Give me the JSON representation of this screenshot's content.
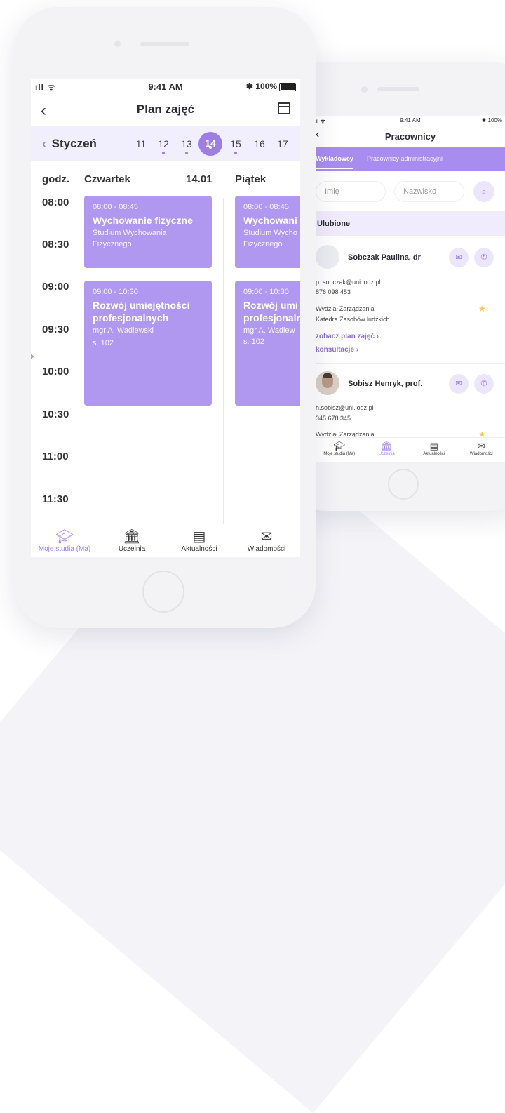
{
  "front": {
    "status": {
      "signal": "ıll ᯤ",
      "time": "9:41 AM",
      "battery": "✱ 100%"
    },
    "title": "Plan zajęć",
    "month": "Styczeń",
    "days": [
      {
        "num": "11",
        "dot": false
      },
      {
        "num": "12",
        "dot": true
      },
      {
        "num": "13",
        "dot": true
      },
      {
        "num": "14",
        "dot": true,
        "selected": true
      },
      {
        "num": "15",
        "dot": true
      },
      {
        "num": "16",
        "dot": false
      },
      {
        "num": "17",
        "dot": false
      }
    ],
    "col_hour": "godz.",
    "col_day1": "Czwartek",
    "col_day1_date": "14.01",
    "col_day2": "Piątek",
    "hours": [
      "08:00",
      "08:30",
      "09:00",
      "09:30",
      "10:00",
      "10:30",
      "11:00",
      "11:30"
    ],
    "events": [
      {
        "time": "08:00 - 08:45",
        "name": "Wychowanie fizyczne",
        "sub": "Studium Wychowania Fizycznego"
      },
      {
        "time": "09:00 - 10:30",
        "name": "Rozwój umiejętności profesjonalnych",
        "sub": "mgr A. Wadlewski",
        "room": "s. 102"
      }
    ],
    "events2": [
      {
        "time": "08:00 - 08:45",
        "name": "Wychowani",
        "sub1": "Studium Wycho",
        "sub2": "Fizycznego"
      },
      {
        "time": "09:00 - 10:30",
        "name1": "Rozwój umi",
        "name2": "profesjonaln",
        "sub1": "mgr A. Wadlew",
        "sub2": "s. 102"
      }
    ],
    "tabs": [
      "Moje studia (Ma)",
      "Uczelnia",
      "Aktualności",
      "Wiadomości"
    ]
  },
  "back": {
    "status": {
      "signal": "ıl ᯤ",
      "time": "9:41 AM",
      "battery": "✱ 100%"
    },
    "title": "Pracownicy",
    "tab_active": "Wykładowcy",
    "tab_other": "Pracownicy administracyjni",
    "first_name_placeholder": "Imię",
    "last_name_placeholder": "Nazwisko",
    "favorites": "Ulubione",
    "people": [
      {
        "name": "Sobczak Paulina, dr",
        "email": "p. sobczak@uni.lodz.pl",
        "phone": "876 098 453",
        "dept": "Wydział Zarządzania",
        "unit": "Katedra Zasobów ludzkich"
      },
      {
        "name": "Sobisz Henryk, prof.",
        "email": "h.sobisz@uni.lodz.pl",
        "phone": "345 678 345",
        "dept": "Wydział Zarządzania"
      }
    ],
    "link_plan": "zobacz plan zajęć  ›",
    "link_consult": "konsultacje  ›",
    "tabs": [
      "Moje studia (Ma)",
      "Uczelnia",
      "Aktualności",
      "Wiadomości"
    ]
  },
  "colors": {
    "accent": "#9e7ee6",
    "event": "#b097f0",
    "light": "#f1eefe"
  },
  "icons": [
    "graduation-cap-icon",
    "university-icon",
    "news-icon",
    "mail-icon",
    "phone-icon",
    "search-icon",
    "star-icon",
    "calendar-icon"
  ]
}
